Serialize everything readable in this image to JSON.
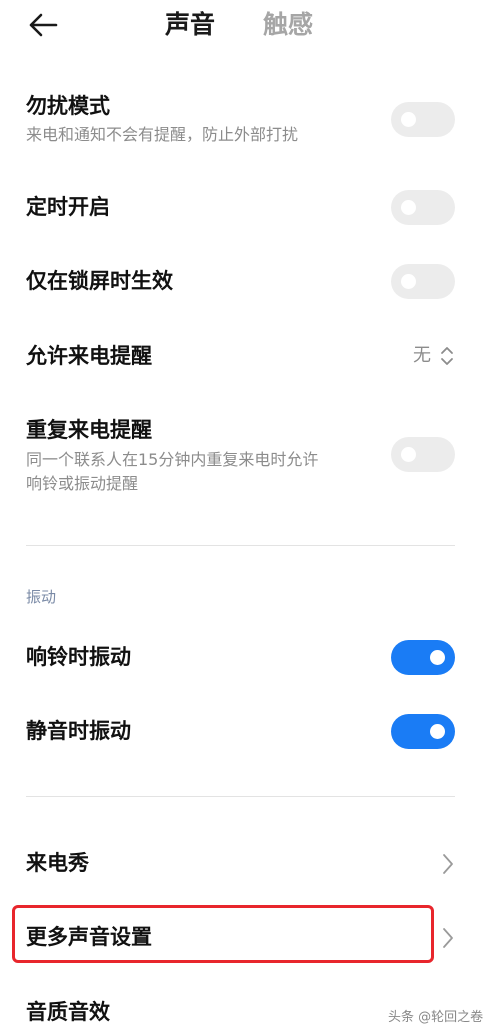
{
  "header": {
    "tabs": [
      {
        "label": "声音",
        "active": true
      },
      {
        "label": "触感",
        "active": false
      }
    ]
  },
  "rows": {
    "dnd": {
      "title": "勿扰模式",
      "subtitle": "来电和通知不会有提醒，防止外部打扰",
      "on": false
    },
    "scheduled": {
      "title": "定时开启",
      "on": false
    },
    "lockscreen_only": {
      "title": "仅在锁屏时生效",
      "on": false
    },
    "allow_calls": {
      "title": "允许来电提醒",
      "value": "无"
    },
    "repeat_calls": {
      "title": "重复来电提醒",
      "subtitle_line1": "同一个联系人在15分钟内重复来电时允许",
      "subtitle_line2": "响铃或振动提醒",
      "on": false
    }
  },
  "vibration": {
    "section_label": "振动",
    "ring_vibrate": {
      "title": "响铃时振动",
      "on": true
    },
    "silent_vibrate": {
      "title": "静音时振动",
      "on": true
    }
  },
  "more": {
    "caller_show": {
      "title": "来电秀"
    },
    "more_sound_settings": {
      "title": "更多声音设置"
    },
    "sound_quality": {
      "title": "音质音效"
    }
  },
  "watermark": "头条 @轮回之卷",
  "colors": {
    "accent": "#1a7cf5",
    "highlight": "#e8262c",
    "toggle_off": "#ececec"
  }
}
